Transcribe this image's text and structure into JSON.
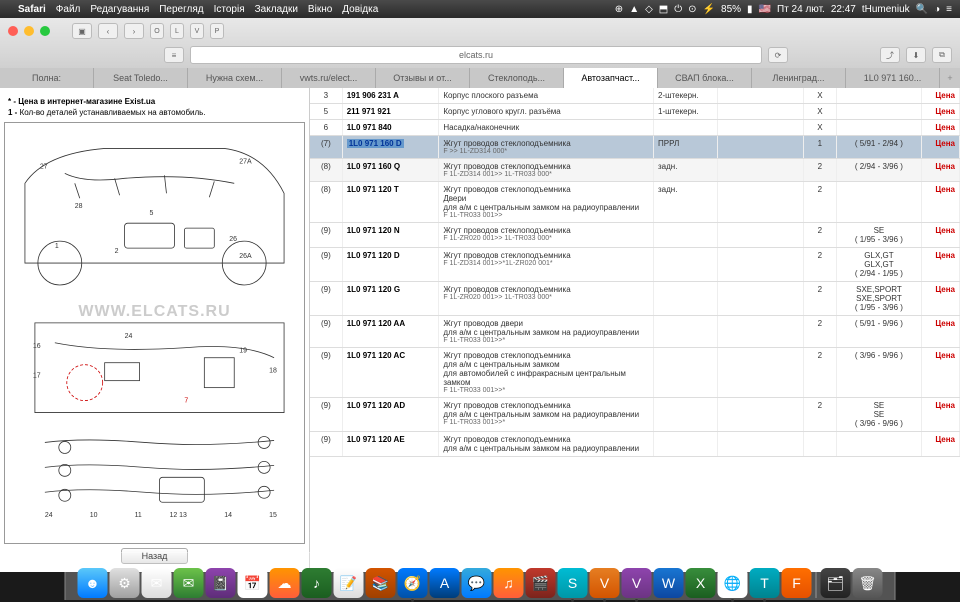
{
  "menubar": {
    "app": "Safari",
    "items": [
      "Файл",
      "Редагування",
      "Перегляд",
      "Історія",
      "Закладки",
      "Вікно",
      "Довідка"
    ],
    "battery": "85%",
    "flag": "🇺🇸",
    "date": "Пт 24 лют.",
    "time": "22:47",
    "user": "tHumeniuk"
  },
  "url": "elcats.ru",
  "tabs": [
    "Полна:",
    "Seat Toledo...",
    "Нужна схем...",
    "vwts.ru/elect...",
    "Отзывы и от...",
    "Стеклоподь...",
    "Автозапчаст...",
    "СВАП блока...",
    "Ленинград...",
    "1L0 971 160..."
  ],
  "activeTab": 6,
  "notes": {
    "l1_prefix": "* - ",
    "l1": "Цена в интернет-магазине Exist.ua",
    "l2_prefix": "1 - ",
    "l2": "Кол-во деталей устанавливаемых на автомобиль."
  },
  "watermark": "WWW.ELCATS.RU",
  "backBtn": "Назад",
  "priceLabel": "Цена",
  "rows": [
    {
      "idx": "3",
      "part": "191 906 231 A",
      "desc": "Корпус плоского разъема",
      "a": "2-штекерн.",
      "b": "",
      "c": "X",
      "d": ""
    },
    {
      "idx": "5",
      "part": "211 971 921",
      "desc": "Корпус углового кругл. разъёма",
      "a": "1-штекерн.",
      "b": "",
      "c": "X",
      "d": ""
    },
    {
      "idx": "6",
      "part": "1L0 971 840",
      "desc": "Насадка/наконечник",
      "a": "",
      "b": "",
      "c": "X",
      "d": ""
    },
    {
      "idx": "(7)",
      "part": "1L0 971 160 D",
      "desc": "Жгут проводов стеклоподъемника",
      "sub": "F >> 1L-ZD314 000*",
      "a": "ПРРЛ",
      "b": "",
      "c": "1",
      "d": "( 5/91 - 2/94 )",
      "sel": true
    },
    {
      "idx": "(8)",
      "part": "1L0 971 160 Q",
      "desc": "Жгут проводов стеклоподъемника",
      "sub": "F 1L-ZD314 001>> 1L-TR033 000*",
      "a": "задн.",
      "b": "",
      "c": "2",
      "d": "( 2/94 - 3/96 )",
      "alt": true
    },
    {
      "idx": "(8)",
      "part": "1L0 971 120 T",
      "desc": "Жгут проводов стеклоподъемника\nДвери\nдля а/м с центральным замком на радиоуправлении",
      "sub": "F 1L-TR033 001>>",
      "a": "задн.",
      "b": "",
      "c": "2",
      "d": ""
    },
    {
      "idx": "(9)",
      "part": "1L0 971 120 N",
      "desc": "Жгут проводов стеклоподъемника",
      "sub": "F 1L-ZR020 001>> 1L-TR033 000*",
      "a": "",
      "b": "",
      "c": "2",
      "d": "SE\n( 1/95 - 3/96 )"
    },
    {
      "idx": "(9)",
      "part": "1L0 971 120 D",
      "desc": "Жгут проводов стеклоподъемника",
      "sub": "F 1L-ZD314 001>>*1L-ZR020 001*",
      "a": "",
      "b": "",
      "c": "2",
      "d": "GLX,GT\nGLX,GT\n( 2/94 - 1/95 )"
    },
    {
      "idx": "(9)",
      "part": "1L0 971 120 G",
      "desc": "Жгут проводов стеклоподъемника",
      "sub": "F 1L-ZR020 001>> 1L-TR033 000*",
      "a": "",
      "b": "",
      "c": "2",
      "d": "SXE,SPORT\nSXE,SPORT\n( 1/95 - 3/96 )"
    },
    {
      "idx": "(9)",
      "part": "1L0 971 120 AA",
      "desc": "Жгут проводов двери\nдля а/м с центральным замком на радиоуправлении",
      "sub": "F 1L-TR033 001>>*",
      "a": "",
      "b": "",
      "c": "2",
      "d": "( 5/91 - 9/96 )"
    },
    {
      "idx": "(9)",
      "part": "1L0 971 120 AC",
      "desc": "Жгут проводов стеклоподъемника\nдля а/м с центральным замком\nдля автомобилей с инфракрасным центральным замком",
      "sub": "F 1L-TR033 001>>*",
      "a": "",
      "b": "",
      "c": "2",
      "d": "( 3/96 - 9/96 )"
    },
    {
      "idx": "(9)",
      "part": "1L0 971 120 AD",
      "desc": "Жгут проводов стеклоподъемника\nдля а/м с центральным замком на радиоуправлении",
      "sub": "F 1L-TR033 001>>*",
      "a": "",
      "b": "",
      "c": "2",
      "d": "SE\nSE\n( 3/96 - 9/96 )"
    },
    {
      "idx": "(9)",
      "part": "1L0 971 120 AE",
      "desc": "Жгут проводов стеклоподъемника\nдля а/м с центральным замком на радиоуправлении",
      "a": "",
      "b": "",
      "c": "",
      "d": ""
    }
  ],
  "dock": [
    {
      "bg": "linear-gradient(#5ac8fa,#007aff)",
      "g": "☻"
    },
    {
      "bg": "linear-gradient(#e0e0e0,#a0a0a0)",
      "g": "⚙"
    },
    {
      "bg": "linear-gradient(#fff,#ddd)",
      "g": "✉"
    },
    {
      "bg": "linear-gradient(#6cc24a,#2e7d32)",
      "g": "✉"
    },
    {
      "bg": "linear-gradient(#8e44ad,#5e2d79)",
      "g": "📓"
    },
    {
      "bg": "#fff",
      "g": "📅"
    },
    {
      "bg": "linear-gradient(#ff9500,#ff5e3a)",
      "g": "☁"
    },
    {
      "bg": "linear-gradient(#2e7d32,#1b5e20)",
      "g": "♪"
    },
    {
      "bg": "linear-gradient(#fff,#ddd)",
      "g": "📝"
    },
    {
      "bg": "linear-gradient(#d35400,#a04000)",
      "g": "📚"
    },
    {
      "bg": "linear-gradient(#007aff,#0051a8)",
      "g": "🧭",
      "run": true
    },
    {
      "bg": "linear-gradient(#007aff,#003d7a)",
      "g": "A"
    },
    {
      "bg": "linear-gradient(#34aadc,#007aff)",
      "g": "💬"
    },
    {
      "bg": "linear-gradient(#ff9500,#ff5e3a)",
      "g": "♫"
    },
    {
      "bg": "linear-gradient(#c0392b,#7b241c)",
      "g": "🎬"
    },
    {
      "bg": "linear-gradient(#00bcd4,#0097a7)",
      "g": "S",
      "run": true
    },
    {
      "bg": "linear-gradient(#e67e22,#d35400)",
      "g": "V",
      "run": true
    },
    {
      "bg": "linear-gradient(#8e44ad,#6c3483)",
      "g": "V",
      "run": true
    },
    {
      "bg": "linear-gradient(#1976d2,#0d47a1)",
      "g": "W"
    },
    {
      "bg": "linear-gradient(#388e3c,#1b5e20)",
      "g": "X"
    },
    {
      "bg": "#fff",
      "g": "🌐",
      "run": true
    },
    {
      "bg": "linear-gradient(#00acc1,#00838f)",
      "g": "T",
      "run": true
    },
    {
      "bg": "linear-gradient(#ff6f00,#e65100)",
      "g": "F"
    },
    {
      "bg": "linear-gradient(#444,#222)",
      "g": "🗂"
    },
    {
      "bg": "linear-gradient(#888,#555)",
      "g": "🗑"
    }
  ]
}
